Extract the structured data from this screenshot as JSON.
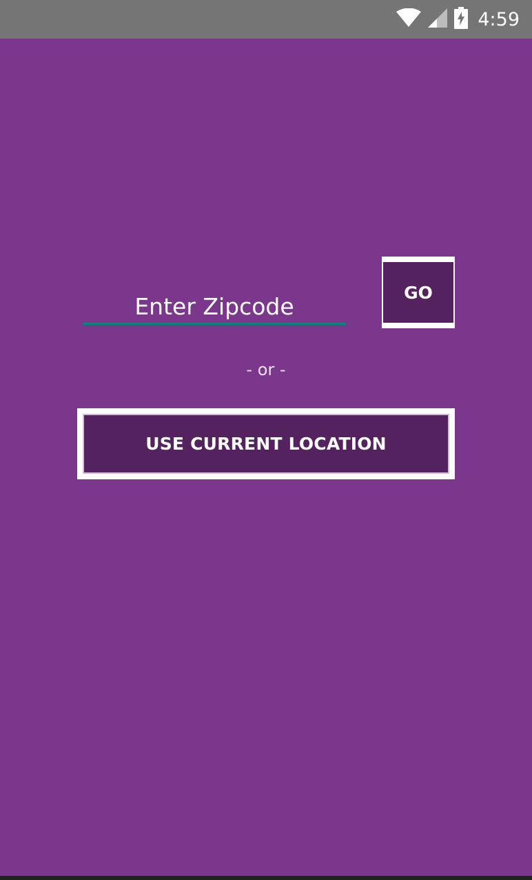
{
  "status_bar": {
    "time": "4:59",
    "icons": [
      "wifi-icon",
      "cell-signal-icon",
      "battery-charging-icon"
    ]
  },
  "form": {
    "zip_input": {
      "value": "",
      "placeholder": "Enter Zipcode"
    },
    "go_label": "GO",
    "or_label": "- or -",
    "location_label": "USE CURRENT LOCATION"
  },
  "colors": {
    "background": "#7a378b",
    "button": "#552260",
    "input_underline": "#00897b",
    "status_bar": "#757575"
  }
}
